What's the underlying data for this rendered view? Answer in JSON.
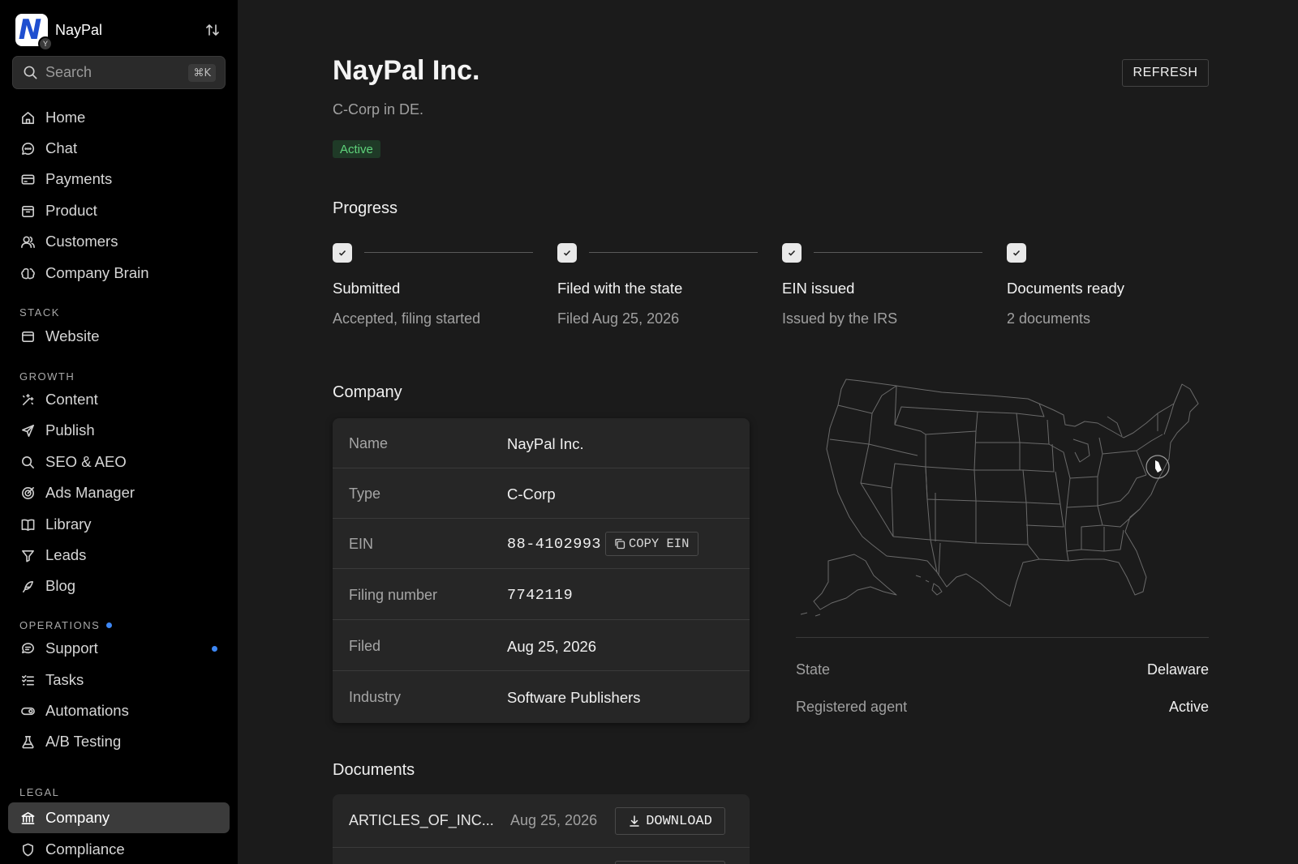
{
  "app": {
    "brand_name": "NayPal",
    "logo_letter": "N",
    "logo_badge": "Y"
  },
  "search": {
    "label": "Search",
    "shortcut": "⌘K"
  },
  "nav": {
    "main": [
      {
        "label": "Home",
        "icon": "home-icon"
      },
      {
        "label": "Chat",
        "icon": "chat-icon"
      },
      {
        "label": "Payments",
        "icon": "payments-icon"
      },
      {
        "label": "Product",
        "icon": "product-icon"
      },
      {
        "label": "Customers",
        "icon": "customers-icon"
      },
      {
        "label": "Company Brain",
        "icon": "brain-icon"
      }
    ],
    "sections": {
      "stack": "STACK",
      "growth": "GROWTH",
      "operations": "OPERATIONS",
      "legal": "LEGAL"
    },
    "stack": [
      {
        "label": "Website",
        "icon": "website-icon"
      }
    ],
    "growth": [
      {
        "label": "Content",
        "icon": "sparkle-icon"
      },
      {
        "label": "Publish",
        "icon": "send-icon"
      },
      {
        "label": "SEO & AEO",
        "icon": "search-icon"
      },
      {
        "label": "Ads Manager",
        "icon": "target-icon"
      },
      {
        "label": "Library",
        "icon": "book-icon"
      },
      {
        "label": "Leads",
        "icon": "filter-icon"
      },
      {
        "label": "Blog",
        "icon": "feather-icon"
      }
    ],
    "operations": [
      {
        "label": "Support",
        "icon": "support-icon"
      },
      {
        "label": "Tasks",
        "icon": "tasks-icon"
      },
      {
        "label": "Automations",
        "icon": "toggle-icon"
      },
      {
        "label": "A/B Testing",
        "icon": "flask-icon"
      }
    ],
    "legal": [
      {
        "label": "Company",
        "icon": "bank-icon",
        "active": true
      },
      {
        "label": "Compliance",
        "icon": "shield-icon"
      }
    ]
  },
  "page": {
    "title": "NayPal Inc.",
    "subtitle": "C-Corp in DE.",
    "status": "Active",
    "refresh_label": "REFRESH"
  },
  "progress": {
    "heading": "Progress",
    "steps": [
      {
        "title": "Submitted",
        "detail": "Accepted, filing started",
        "done": true
      },
      {
        "title": "Filed with the state",
        "detail": "Filed Aug 25, 2026",
        "done": true
      },
      {
        "title": "EIN issued",
        "detail": "Issued by the IRS",
        "done": true
      },
      {
        "title": "Documents ready",
        "detail": "2 documents",
        "done": true
      }
    ]
  },
  "company": {
    "heading": "Company",
    "rows": [
      {
        "key": "Name",
        "value": "NayPal Inc."
      },
      {
        "key": "Type",
        "value": "C-Corp"
      },
      {
        "key": "EIN",
        "value": "88-4102993"
      },
      {
        "key": "Filing number",
        "value": "7742119"
      },
      {
        "key": "Filed",
        "value": "Aug 25, 2026"
      },
      {
        "key": "Industry",
        "value": "Software Publishers"
      }
    ],
    "copy_ein_label": "COPY EIN"
  },
  "state_info": {
    "state_label": "State",
    "state_value": "Delaware",
    "agent_label": "Registered agent",
    "agent_value": "Active"
  },
  "documents": {
    "heading": "Documents",
    "items": [
      {
        "name": "ARTICLES_OF_INC...",
        "date": "Aug 25, 2026",
        "action": "DOWNLOAD"
      }
    ]
  },
  "colors": {
    "accent_blue": "#3d87f5",
    "status_green": "#5fd37b",
    "logo_blue": "#1f4fd0"
  }
}
